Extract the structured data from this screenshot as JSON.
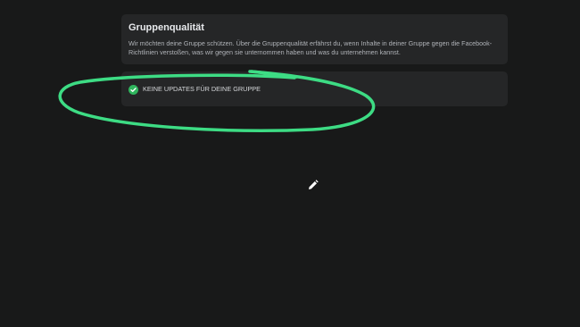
{
  "group_quality": {
    "title": "Gruppenqualität",
    "description": "Wir möchten deine Gruppe schützen. Über die Gruppenqualität erfährst du, wenn Inhalte in deiner Gruppe gegen die Facebook-Richtlinien verstoßen, was wir gegen sie unternommen haben und was du unternehmen kannst."
  },
  "status": {
    "icon": "check-circle-icon",
    "label": "KEINE UPDATES FÜR DEINE GRUPPE"
  },
  "colors": {
    "background": "#181919",
    "card": "#252627",
    "check_green": "#2fb55d",
    "annotation_green": "#3ddc84"
  },
  "cursor": {
    "icon": "pencil-icon"
  }
}
